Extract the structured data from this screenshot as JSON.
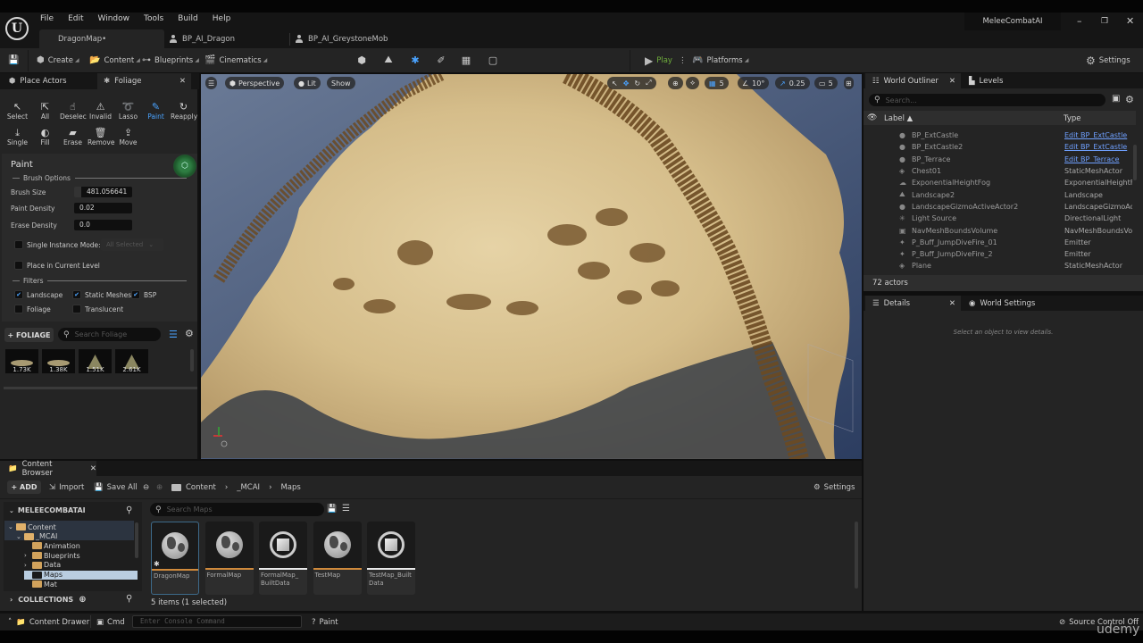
{
  "app": {
    "project_name": "MeleeCombatAI",
    "menu": [
      "File",
      "Edit",
      "Window",
      "Tools",
      "Build",
      "Help"
    ],
    "document_tabs": [
      {
        "label": "DragonMap•",
        "active": true
      },
      {
        "label": "BP_AI_Dragon",
        "active": false
      },
      {
        "label": "BP_AI_GreystoneMob",
        "active": false
      }
    ],
    "window_controls": {
      "minimize": "–",
      "restore": "❐",
      "close": "✕"
    }
  },
  "toolbar": {
    "create": "Create",
    "content": "Content",
    "blueprints": "Blueprints",
    "cinematics": "Cinematics",
    "modes": [
      "select-mode",
      "landscape-mode",
      "foliage-mode",
      "mesh-paint-mode",
      "fracture-mode",
      "brush-edit-mode"
    ],
    "play": "Play",
    "platforms": "Platforms",
    "settings": "Settings"
  },
  "left_panel": {
    "tabs": [
      {
        "label": "Place Actors",
        "active": false
      },
      {
        "label": "Foliage",
        "active": true
      }
    ],
    "tools_row1": [
      {
        "label": "Select",
        "icon": "↖"
      },
      {
        "label": "All",
        "icon": "⇱"
      },
      {
        "label": "Deselec",
        "icon": "☝"
      },
      {
        "label": "Invalid",
        "icon": "⚠"
      },
      {
        "label": "Lasso",
        "icon": "➰"
      },
      {
        "label": "Paint",
        "icon": "✎",
        "selected": true
      },
      {
        "label": "Reapply",
        "icon": "↻"
      }
    ],
    "tools_row2": [
      {
        "label": "Single",
        "icon": "⤓"
      },
      {
        "label": "Fill",
        "icon": "◐"
      },
      {
        "label": "Erase",
        "icon": "▰"
      },
      {
        "label": "Remove",
        "icon": "🗑"
      },
      {
        "label": "Move",
        "icon": "⇪"
      }
    ],
    "section_title": "Paint",
    "brush_options_label": "Brush Options",
    "brush_size_label": "Brush Size",
    "brush_size_value": "481.056641",
    "paint_density_label": "Paint Density",
    "paint_density_value": "0.02",
    "erase_density_label": "Erase Density",
    "erase_density_value": "0.0",
    "single_instance_label": "Single Instance Mode:",
    "single_instance_checked": false,
    "single_instance_select": "All Selected",
    "place_in_level_label": "Place in Current Level",
    "place_in_level_checked": false,
    "filters_label": "Filters",
    "filters": [
      {
        "label": "Landscape",
        "checked": true
      },
      {
        "label": "Static Meshes",
        "checked": true
      },
      {
        "label": "BSP",
        "checked": true
      },
      {
        "label": "Foliage",
        "checked": false
      },
      {
        "label": "Translucent",
        "checked": false
      }
    ],
    "add_foliage_label": "+ FOLIAGE",
    "search_foliage_placeholder": "Search Foliage",
    "foliage_items": [
      {
        "count": "1.73K",
        "kind": "rock"
      },
      {
        "count": "1.38K",
        "kind": "rock"
      },
      {
        "count": "1.51K",
        "kind": "bush"
      },
      {
        "count": "2.61K",
        "kind": "bush"
      }
    ]
  },
  "viewport": {
    "view_mode": "Perspective",
    "lighting": "Lit",
    "show": "Show",
    "grid_snap": "5",
    "rotation_snap": "10°",
    "scale_snap": "0.25",
    "camera_speed": "5"
  },
  "outliner": {
    "tabs": [
      {
        "label": "World Outliner",
        "active": true
      },
      {
        "label": "Levels",
        "active": false
      }
    ],
    "search_placeholder": "Search...",
    "col_label": "Label ▲",
    "col_type": "Type",
    "rows": [
      {
        "label": "BP_ExtCastle",
        "type": "Edit BP_ExtCastle",
        "link": true,
        "icon": "●"
      },
      {
        "label": "BP_ExtCastle2",
        "type": "Edit BP_ExtCastle",
        "link": true,
        "icon": "●"
      },
      {
        "label": "BP_Terrace",
        "type": "Edit BP_Terrace",
        "link": true,
        "icon": "●"
      },
      {
        "label": "Chest01",
        "type": "StaticMeshActor",
        "link": false,
        "icon": "◈"
      },
      {
        "label": "ExponentialHeightFog",
        "type": "ExponentialHeightFog",
        "link": false,
        "icon": "☁"
      },
      {
        "label": "Landscape2",
        "type": "Landscape",
        "link": false,
        "icon": "⛰"
      },
      {
        "label": "LandscapeGizmoActiveActor2",
        "type": "LandscapeGizmoActor",
        "link": false,
        "icon": "●"
      },
      {
        "label": "Light Source",
        "type": "DirectionalLight",
        "link": false,
        "icon": "✳"
      },
      {
        "label": "NavMeshBoundsVolume",
        "type": "NavMeshBoundsVolume",
        "link": false,
        "icon": "▣"
      },
      {
        "label": "P_Buff_JumpDiveFire_01",
        "type": "Emitter",
        "link": false,
        "icon": "✦"
      },
      {
        "label": "P_Buff_JumpDiveFire_2",
        "type": "Emitter",
        "link": false,
        "icon": "✦"
      },
      {
        "label": "Plane",
        "type": "StaticMeshActor",
        "link": false,
        "icon": "◈"
      }
    ],
    "actor_count": "72 actors"
  },
  "details": {
    "tabs": [
      {
        "label": "Details",
        "active": true
      },
      {
        "label": "World Settings",
        "active": false
      }
    ],
    "empty_message": "Select an object to view details."
  },
  "content_browser": {
    "tab_label": "Content Browser",
    "add_label": "+ ADD",
    "import_label": "Import",
    "save_all_label": "Save All",
    "breadcrumb": [
      "Content",
      "_MCAI",
      "Maps"
    ],
    "settings_label": "Settings",
    "project_root": "MELEECOMBATAI",
    "tree": [
      {
        "label": "Content",
        "depth": 0,
        "expanded": true
      },
      {
        "label": "_MCAI",
        "depth": 1,
        "expanded": true
      },
      {
        "label": "Animation",
        "depth": 2,
        "expanded": false,
        "has_children": false
      },
      {
        "label": "Blueprints",
        "depth": 2,
        "expanded": false,
        "has_children": true
      },
      {
        "label": "Data",
        "depth": 2,
        "expanded": false,
        "has_children": true
      },
      {
        "label": "Maps",
        "depth": 2,
        "selected": true
      },
      {
        "label": "Mat",
        "depth": 2
      }
    ],
    "collections_label": "COLLECTIONS",
    "search_placeholder": "Search Maps",
    "assets": [
      {
        "name": "DragonMap",
        "kind": "map",
        "selected": true,
        "bar_color": "#d08a3c"
      },
      {
        "name": "FormalMap",
        "kind": "map",
        "bar_color": "#d08a3c"
      },
      {
        "name": "FormalMap_ BuiltData",
        "kind": "data",
        "bar_color": "#e8e8e8"
      },
      {
        "name": "TestMap",
        "kind": "map",
        "bar_color": "#d08a3c"
      },
      {
        "name": "TestMap_Built Data",
        "kind": "data",
        "bar_color": "#e8e8e8"
      }
    ],
    "status": "5 items (1 selected)"
  },
  "statusbar": {
    "content_drawer": "Content Drawer",
    "cmd": "Cmd",
    "console_placeholder": "Enter Console Command",
    "mode": "Paint",
    "source_control": "Source Control Off"
  },
  "watermark": "udemy"
}
